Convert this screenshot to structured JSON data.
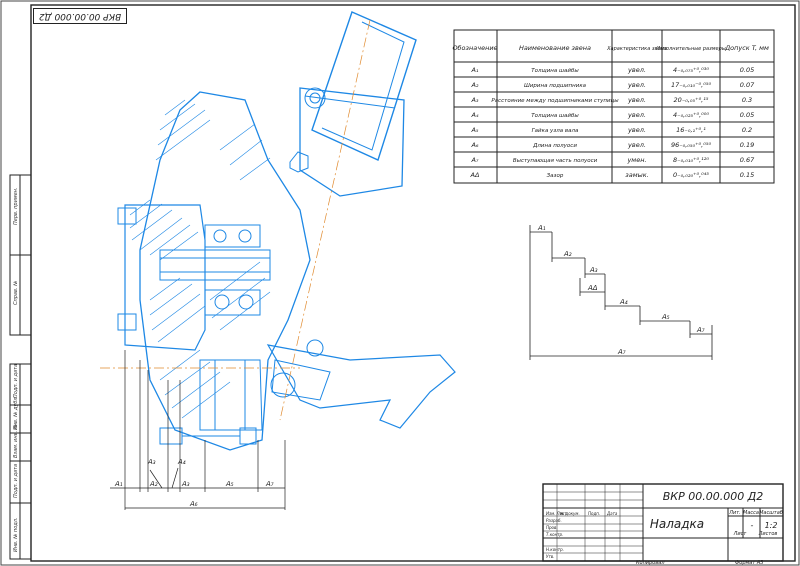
{
  "stamp_top": "ВКР 00.00.000 Д2",
  "sidebar_labels": [
    "Перв. примен.",
    "Справ. №",
    "Подп. и дата",
    "Инв. № дубл.",
    "Взам. инв. №",
    "Подп. и дата",
    "Инв. № подл."
  ],
  "table": {
    "headers": [
      "Обозначение",
      "Наименование звена",
      "Характеристика звена",
      "Исполнительные размеры",
      "Допуск T, мм"
    ],
    "rows": [
      {
        "sym": "A₁",
        "name": "Толщина шайбы",
        "kind": "увел.",
        "size": "4₋₀,₀₇₅⁺⁰,⁰³⁰",
        "tol": "0.05"
      },
      {
        "sym": "A₂",
        "name": "Ширина подшипника",
        "kind": "увел.",
        "size": "17₋₀,₀₁₀⁻⁰,⁰⁵⁰",
        "tol": "0.07"
      },
      {
        "sym": "A₃",
        "name": "Расстояние между подшипниками ступицы",
        "kind": "увел.",
        "size": "20₋₀,₀₅⁺⁰,¹⁵",
        "tol": "0.3"
      },
      {
        "sym": "A₄",
        "name": "Толщина шайбы",
        "kind": "увел.",
        "size": "4₋₀,₀₂₅⁺⁰,⁰⁰⁰",
        "tol": "0.05"
      },
      {
        "sym": "A₅",
        "name": "Гайка узла вала",
        "kind": "увел.",
        "size": "16₋₀,₁⁺⁰,¹",
        "tol": "0.2"
      },
      {
        "sym": "A₆",
        "name": "Длина полуоси",
        "kind": "увел.",
        "size": "96₋₀,₀₅₀⁺⁰,⁰⁵⁰",
        "tol": "0.19"
      },
      {
        "sym": "A₇",
        "name": "Выступающая часть полуоси",
        "kind": "умен.",
        "size": "8₋₀,₀₁₀⁺⁰,¹²⁰",
        "tol": "0.67"
      },
      {
        "sym": "AΔ",
        "name": "Зазор",
        "kind": "замык.",
        "size": "0₋₀,₀₂₀⁺⁰,⁰⁴⁵",
        "tol": "0.15"
      }
    ]
  },
  "scheme_labels": [
    "A₁",
    "A₂",
    "A₃",
    "AΔ",
    "A₄",
    "A₅",
    "A₆",
    "A₇"
  ],
  "scheme_total": "A₇",
  "drawing_labels": {
    "bottom": [
      "A₁",
      "A₂",
      "A₃",
      "A₅",
      "A₇",
      "A₆"
    ],
    "delta": "A₃",
    "a4": "A₄"
  },
  "title_block": {
    "code": "ВКР 00.00.000 Д2",
    "name": "Наладка",
    "lit_label": "Лит.",
    "mass_label": "Масса",
    "scale_label": "Масштаб",
    "mass": "-",
    "scale": "1:2",
    "sheet_label": "Лист",
    "sheets_label": "Листов",
    "rows": [
      "Изм. Лист",
      "№ докум.",
      "Подп.",
      "Дата",
      "Разраб.",
      "Пров.",
      "Т.контр.",
      "Н.контр.",
      "Утв."
    ],
    "copied": "Копировал",
    "format": "Формат  А3"
  },
  "colors": {
    "line": "#1e88e5",
    "ink": "#222222",
    "axis": "#e08a2e"
  }
}
